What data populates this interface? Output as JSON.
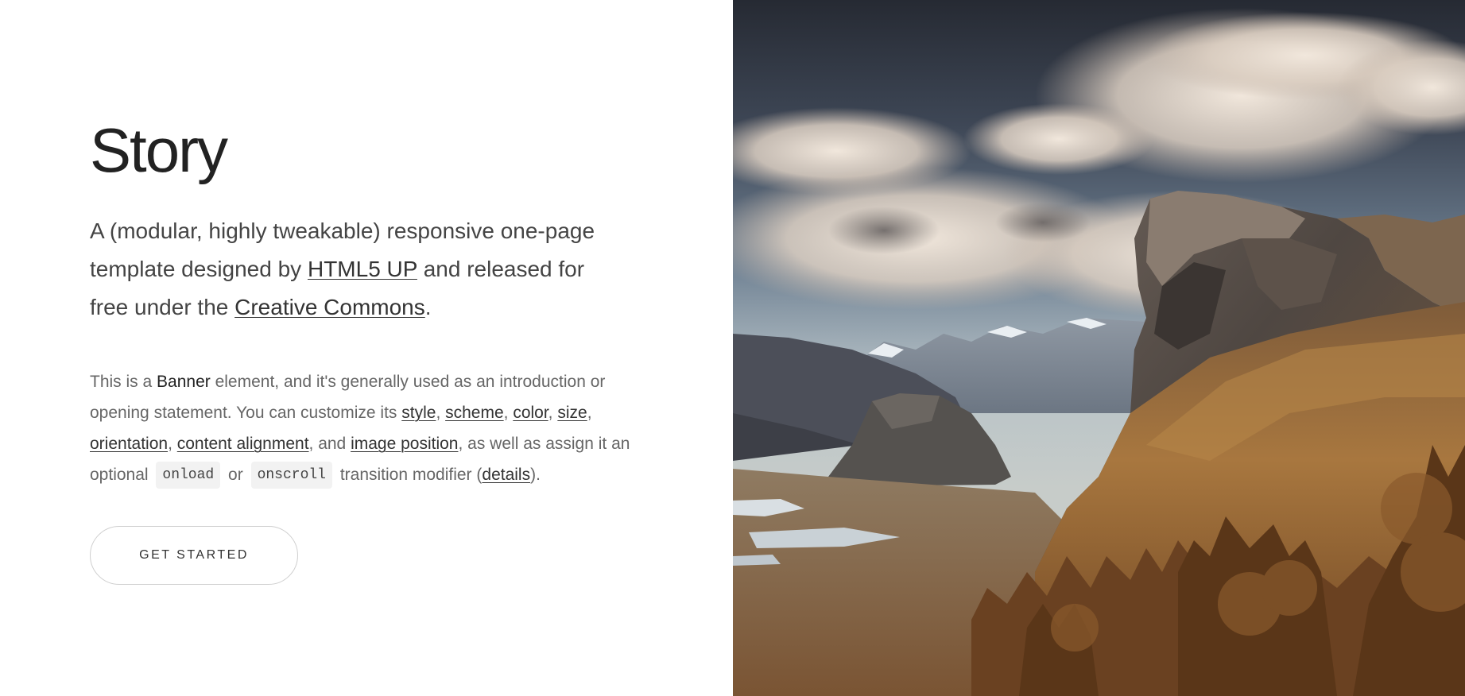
{
  "banner": {
    "title": "Story",
    "lead": {
      "before_link1": "A (modular, highly tweakable) responsive one-page template designed by ",
      "link1": "HTML5 UP",
      "between_links": " and released for free under the ",
      "link2": "Creative Commons",
      "after_link2": "."
    },
    "description": {
      "t1": "This is a ",
      "strong": "Banner",
      "t2": " element, and it's generally used as an introduction or opening statement. You can customize its ",
      "link_style": "style",
      "sep1": ", ",
      "link_scheme": "scheme",
      "sep2": ", ",
      "link_color": "color",
      "sep3": ", ",
      "link_size": "size",
      "sep4": ", ",
      "link_orientation": "orientation",
      "sep5": ", ",
      "link_content_alignment": "content alignment",
      "t3": ", and ",
      "link_image_position": "image position",
      "t4": ", as well as assign it an optional ",
      "code1": "onload",
      "t5": " or ",
      "code2": "onscroll",
      "t6": " transition modifier (",
      "link_details": "details",
      "t7": ")."
    },
    "button_label": "GET STARTED"
  },
  "image": {
    "subject": "mountain-valley-landscape",
    "colors": {
      "sky_dark": "#2c3038",
      "cloud": "#e8ddd3",
      "mountain_rock": "#4a4a4c",
      "slope_brown": "#9a6d3d",
      "tree_brown": "#7a4a22"
    }
  }
}
